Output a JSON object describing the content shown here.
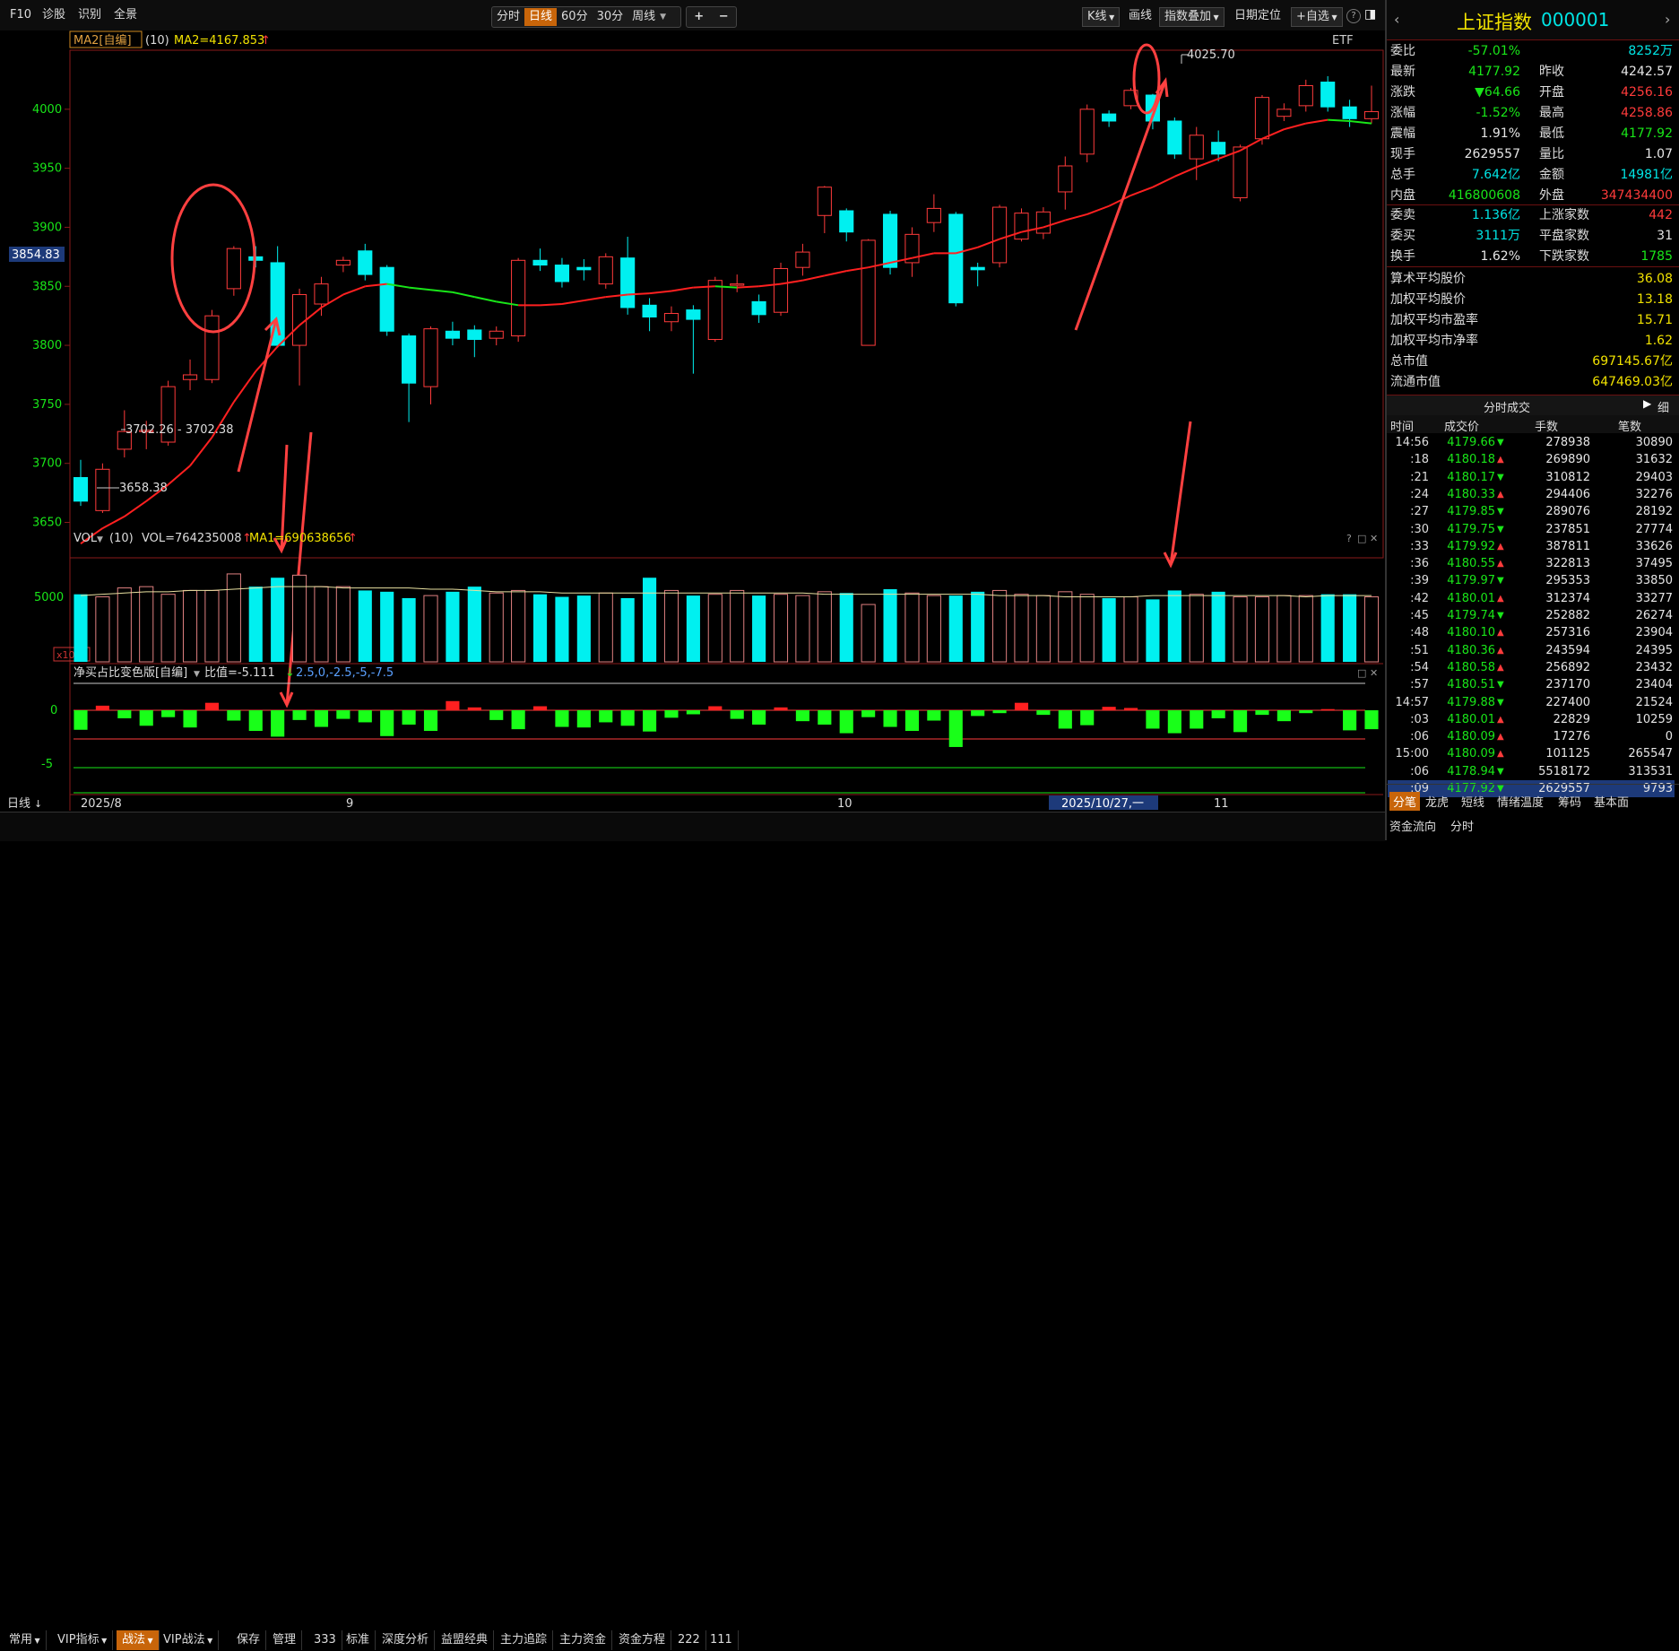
{
  "toolbar": {
    "f10": "F10",
    "diagnose": "诊股",
    "identify": "识别",
    "panorama": "全景",
    "periods": [
      "分时",
      "日线",
      "60分",
      "30分",
      "周线"
    ],
    "active_period": "日线",
    "zoom_in": "+",
    "zoom_out": "−",
    "kline": "K线",
    "draw": "画线",
    "index_overlay": "指数叠加",
    "date_locate": "日期定位",
    "add_watch": "+自选",
    "help": "?"
  },
  "main_chart": {
    "indicator_name": "MA2[自编]",
    "indicator_param": "(10)",
    "ma2_value": "MA2=4167.853",
    "etf_label": "ETF",
    "price_axis": [
      "4000",
      "3950",
      "3900",
      "3850",
      "3800",
      "3750",
      "3700",
      "3650"
    ],
    "current_price_marker": "3854.83",
    "annot_high": "4025.70",
    "annot_range": "3702.26 - 3702.38",
    "annot_low": "3658.38"
  },
  "vol_panel": {
    "name": "VOL",
    "param": "(10)",
    "vol_value": "VOL=764235008",
    "ma1_value": "MA1=690638656",
    "axis": [
      "5000"
    ],
    "unit": "x10万"
  },
  "net_panel": {
    "name": "净买占比变色版[自编]",
    "ratio": "比值=-5.111",
    "levels": "2.5,0,-2.5,-5,-7.5",
    "axis": [
      "0",
      "-5"
    ]
  },
  "date_axis": {
    "period_label": "日线",
    "labels": [
      "2025/8",
      "9",
      "10",
      "11"
    ],
    "highlight": "2025/10/27,一"
  },
  "right_panel": {
    "title": "上证指数",
    "code": "000001",
    "rows": [
      {
        "l1": "委比",
        "v1": "-57.01%",
        "c1": "grn",
        "l2": "",
        "v2": "8252万",
        "c2": "cyan"
      },
      {
        "l1": "最新",
        "v1": "4177.92",
        "c1": "grn",
        "l2": "昨收",
        "v2": "4242.57",
        "c2": "wht"
      },
      {
        "l1": "涨跌",
        "v1": "▼64.66",
        "c1": "grn",
        "l2": "开盘",
        "v2": "4256.16",
        "c2": "red"
      },
      {
        "l1": "涨幅",
        "v1": "-1.52%",
        "c1": "grn",
        "l2": "最高",
        "v2": "4258.86",
        "c2": "red"
      },
      {
        "l1": "震幅",
        "v1": "1.91%",
        "c1": "wht",
        "l2": "最低",
        "v2": "4177.92",
        "c2": "grn"
      },
      {
        "l1": "现手",
        "v1": "2629557",
        "c1": "wht",
        "l2": "量比",
        "v2": "1.07",
        "c2": "wht"
      },
      {
        "l1": "总手",
        "v1": "7.642亿",
        "c1": "cyan",
        "l2": "金额",
        "v2": "14981亿",
        "c2": "cyan"
      },
      {
        "l1": "内盘",
        "v1": "416800608",
        "c1": "grn",
        "l2": "外盘",
        "v2": "347434400",
        "c2": "red"
      }
    ],
    "rows2": [
      {
        "l1": "委卖",
        "v1": "1.136亿",
        "c1": "cyan",
        "l2": "上涨家数",
        "v2": "442",
        "c2": "red"
      },
      {
        "l1": "委买",
        "v1": "3111万",
        "c1": "cyan",
        "l2": "平盘家数",
        "v2": "31",
        "c2": "wht"
      },
      {
        "l1": "换手",
        "v1": "1.62%",
        "c1": "wht",
        "l2": "下跌家数",
        "v2": "1785",
        "c2": "grn"
      }
    ],
    "stats": [
      {
        "l": "算术平均股价",
        "v": "36.08"
      },
      {
        "l": "加权平均股价",
        "v": "13.18"
      },
      {
        "l": "加权平均市盈率",
        "v": "15.71"
      },
      {
        "l": "加权平均市净率",
        "v": "1.62"
      },
      {
        "l": "总市值",
        "v": "697145.67亿"
      },
      {
        "l": "流通市值",
        "v": "647469.03亿"
      }
    ],
    "ticks_title": "分时成交",
    "ticks_detail": "细",
    "ticks_headers": [
      "时间",
      "成交价",
      "手数",
      "笔数"
    ],
    "ticks": [
      {
        "t": "14:56",
        "p": "4179.66",
        "d": "▼",
        "h": "278938",
        "n": "30890"
      },
      {
        "t": ":18",
        "p": "4180.18",
        "d": "▲",
        "h": "269890",
        "n": "31632"
      },
      {
        "t": ":21",
        "p": "4180.17",
        "d": "▼",
        "h": "310812",
        "n": "29403"
      },
      {
        "t": ":24",
        "p": "4180.33",
        "d": "▲",
        "h": "294406",
        "n": "32276"
      },
      {
        "t": ":27",
        "p": "4179.85",
        "d": "▼",
        "h": "289076",
        "n": "28192"
      },
      {
        "t": ":30",
        "p": "4179.75",
        "d": "▼",
        "h": "237851",
        "n": "27774"
      },
      {
        "t": ":33",
        "p": "4179.92",
        "d": "▲",
        "h": "387811",
        "n": "33626"
      },
      {
        "t": ":36",
        "p": "4180.55",
        "d": "▲",
        "h": "322813",
        "n": "37495"
      },
      {
        "t": ":39",
        "p": "4179.97",
        "d": "▼",
        "h": "295353",
        "n": "33850"
      },
      {
        "t": ":42",
        "p": "4180.01",
        "d": "▲",
        "h": "312374",
        "n": "33277"
      },
      {
        "t": ":45",
        "p": "4179.74",
        "d": "▼",
        "h": "252882",
        "n": "26274"
      },
      {
        "t": ":48",
        "p": "4180.10",
        "d": "▲",
        "h": "257316",
        "n": "23904"
      },
      {
        "t": ":51",
        "p": "4180.36",
        "d": "▲",
        "h": "243594",
        "n": "24395"
      },
      {
        "t": ":54",
        "p": "4180.58",
        "d": "▲",
        "h": "256892",
        "n": "23432"
      },
      {
        "t": ":57",
        "p": "4180.51",
        "d": "▼",
        "h": "237170",
        "n": "23404"
      },
      {
        "t": "14:57",
        "p": "4179.88",
        "d": "▼",
        "h": "227400",
        "n": "21524"
      },
      {
        "t": ":03",
        "p": "4180.01",
        "d": "▲",
        "h": "22829",
        "n": "10259"
      },
      {
        "t": ":06",
        "p": "4180.09",
        "d": "▲",
        "h": "17276",
        "n": "0"
      },
      {
        "t": "15:00",
        "p": "4180.09",
        "d": "▲",
        "h": "101125",
        "n": "265547"
      },
      {
        "t": ":06",
        "p": "4178.94",
        "d": "▼",
        "h": "5518172",
        "n": "313531"
      },
      {
        "t": ":09",
        "p": "4177.92",
        "d": "▼",
        "h": "2629557",
        "n": "9793"
      }
    ],
    "bottom_tabs": [
      "分笔",
      "龙虎",
      "短线",
      "情绪温度",
      "筹码",
      "基本面"
    ],
    "bottom_tabs2": [
      "资金流向",
      "分时"
    ]
  },
  "bottom_bar": {
    "tabs": [
      "常用",
      "VIP指标",
      "战法",
      "VIP战法",
      "保存",
      "管理",
      "333",
      "标准",
      "深度分析",
      "益盟经典",
      "主力追踪",
      "主力资金",
      "资金方程",
      "222",
      "111"
    ]
  },
  "chart_data": {
    "type": "candlestick",
    "title": "上证指数",
    "ylim": [
      3620,
      4050
    ],
    "candles": [
      [
        3688,
        3668,
        3703,
        3664
      ],
      [
        3660,
        3695,
        3700,
        3658
      ],
      [
        3712,
        3727,
        3745,
        3705
      ],
      [
        3727,
        3728,
        3736,
        3712
      ],
      [
        3718,
        3765,
        3770,
        3715
      ],
      [
        3771,
        3775,
        3788,
        3762
      ],
      [
        3771,
        3825,
        3830,
        3768
      ],
      [
        3848,
        3882,
        3884,
        3842
      ],
      [
        3875,
        3872,
        3884,
        3866
      ],
      [
        3870,
        3800,
        3884,
        3798
      ],
      [
        3800,
        3843,
        3848,
        3766
      ],
      [
        3835,
        3852,
        3858,
        3825
      ],
      [
        3868,
        3872,
        3875,
        3862
      ],
      [
        3880,
        3860,
        3886,
        3855
      ],
      [
        3866,
        3812,
        3868,
        3808
      ],
      [
        3808,
        3768,
        3810,
        3735
      ],
      [
        3765,
        3814,
        3816,
        3750
      ],
      [
        3812,
        3806,
        3820,
        3800
      ],
      [
        3813,
        3805,
        3817,
        3790
      ],
      [
        3806,
        3812,
        3816,
        3800
      ],
      [
        3808,
        3872,
        3874,
        3803
      ],
      [
        3872,
        3868,
        3882,
        3863
      ],
      [
        3868,
        3854,
        3874,
        3849
      ],
      [
        3866,
        3864,
        3873,
        3855
      ],
      [
        3852,
        3875,
        3878,
        3848
      ],
      [
        3874,
        3832,
        3892,
        3826
      ],
      [
        3834,
        3824,
        3840,
        3812
      ],
      [
        3820,
        3827,
        3833,
        3812
      ],
      [
        3830,
        3822,
        3834,
        3776
      ],
      [
        3805,
        3855,
        3858,
        3803
      ],
      [
        3852,
        3852,
        3860,
        3845
      ],
      [
        3837,
        3826,
        3843,
        3819
      ],
      [
        3828,
        3865,
        3870,
        3825
      ],
      [
        3866,
        3879,
        3886,
        3859
      ],
      [
        3910,
        3934,
        3935,
        3895
      ],
      [
        3914,
        3896,
        3916,
        3888
      ],
      [
        3800,
        3889,
        3890,
        3800
      ],
      [
        3911,
        3866,
        3914,
        3860
      ],
      [
        3870,
        3894,
        3900,
        3858
      ],
      [
        3904,
        3916,
        3928,
        3896
      ],
      [
        3911,
        3836,
        3913,
        3833
      ],
      [
        3866,
        3864,
        3870,
        3850
      ],
      [
        3870,
        3917,
        3919,
        3866
      ],
      [
        3890,
        3912,
        3916,
        3888
      ],
      [
        3895,
        3913,
        3917,
        3890
      ],
      [
        3930,
        3952,
        3960,
        3915
      ],
      [
        3962,
        4000,
        4004,
        3955
      ],
      [
        3996,
        3990,
        3999,
        3985
      ],
      [
        4003,
        4016,
        4018,
        4000
      ],
      [
        4012,
        3990,
        4013,
        3983
      ],
      [
        3990,
        3962,
        3993,
        3958
      ],
      [
        3958,
        3978,
        3985,
        3940
      ],
      [
        3972,
        3962,
        3982,
        3956
      ],
      [
        3925,
        3968,
        3970,
        3922
      ],
      [
        3975,
        4010,
        4012,
        3970
      ],
      [
        3994,
        4000,
        4005,
        3990
      ],
      [
        4003,
        4020,
        4025,
        3998
      ],
      [
        4023,
        4002,
        4028,
        3998
      ],
      [
        4002,
        3992,
        4008,
        3985
      ],
      [
        3992,
        3998,
        4020,
        3988
      ]
    ],
    "volumes": [
      5.3,
      5.1,
      5.8,
      5.9,
      5.3,
      5.6,
      5.6,
      6.9,
      5.9,
      6.6,
      6.8,
      5.9,
      5.9,
      5.6,
      5.5,
      5.0,
      5.2,
      5.5,
      5.9,
      5.4,
      5.6,
      5.3,
      5.1,
      5.2,
      5.4,
      5.0,
      6.6,
      5.6,
      5.2,
      5.3,
      5.6,
      5.2,
      5.3,
      5.2,
      5.5,
      5.4,
      4.5,
      5.7,
      5.4,
      5.2,
      5.2,
      5.5,
      5.6,
      5.3,
      5.2,
      5.5,
      5.3,
      5.0,
      5.1,
      4.9,
      5.6,
      5.3,
      5.5,
      5.1,
      5.1,
      5.2,
      5.2,
      5.3,
      5.3,
      5.1
    ],
    "vol_ma": [
      5.2,
      5.3,
      5.4,
      5.5,
      5.5,
      5.6,
      5.6,
      5.7,
      5.8,
      5.9,
      5.9,
      5.9,
      5.8,
      5.8,
      5.8,
      5.8,
      5.7,
      5.7,
      5.6,
      5.5,
      5.5,
      5.5,
      5.4,
      5.4,
      5.4,
      5.4,
      5.4,
      5.4,
      5.4,
      5.4,
      5.4,
      5.4,
      5.4,
      5.4,
      5.3,
      5.3,
      5.3,
      5.3,
      5.3,
      5.3,
      5.3,
      5.3,
      5.2,
      5.2,
      5.2,
      5.1,
      5.1,
      5.1,
      5.1,
      5.2,
      5.2,
      5.2,
      5.2,
      5.2,
      5.2,
      5.2,
      5.1,
      5.2,
      5.2,
      5.2
    ],
    "net_ratio": [
      -3.4,
      0.8,
      -1.4,
      -2.7,
      -1.2,
      -3.0,
      1.3,
      -1.8,
      -3.6,
      -4.6,
      -1.7,
      -2.9,
      -1.5,
      -2.1,
      -4.5,
      -2.5,
      -3.6,
      1.6,
      0.5,
      -1.7,
      -3.3,
      0.7,
      -2.9,
      -3.0,
      -2.1,
      -2.7,
      -3.7,
      -1.3,
      -0.7,
      0.7,
      -1.5,
      -2.5,
      0.5,
      -1.9,
      -2.5,
      -4.0,
      -1.2,
      -2.9,
      -3.6,
      -1.8,
      -6.4,
      -1.0,
      -0.5,
      1.3,
      -0.8,
      -3.2,
      -2.6,
      0.6,
      0.4,
      -3.2,
      -4.0,
      -3.2,
      -1.4,
      -3.8,
      -0.8,
      -1.9,
      -0.5,
      0.2,
      -3.5,
      -3.3
    ],
    "ma_line": [
      3632,
      3645,
      3655,
      3668,
      3682,
      3698,
      3722,
      3752,
      3778,
      3799,
      3817,
      3832,
      3843,
      3850,
      3852,
      3849,
      3847,
      3845,
      3841,
      3837,
      3834,
      3834,
      3835,
      3838,
      3841,
      3843,
      3844,
      3846,
      3849,
      3850,
      3849,
      3850,
      3852,
      3855,
      3859,
      3863,
      3866,
      3870,
      3874,
      3878,
      3878,
      3883,
      3890,
      3896,
      3900,
      3906,
      3911,
      3918,
      3927,
      3934,
      3943,
      3951,
      3958,
      3965,
      3975,
      3983,
      3988,
      3991,
      3990,
      3988
    ]
  }
}
